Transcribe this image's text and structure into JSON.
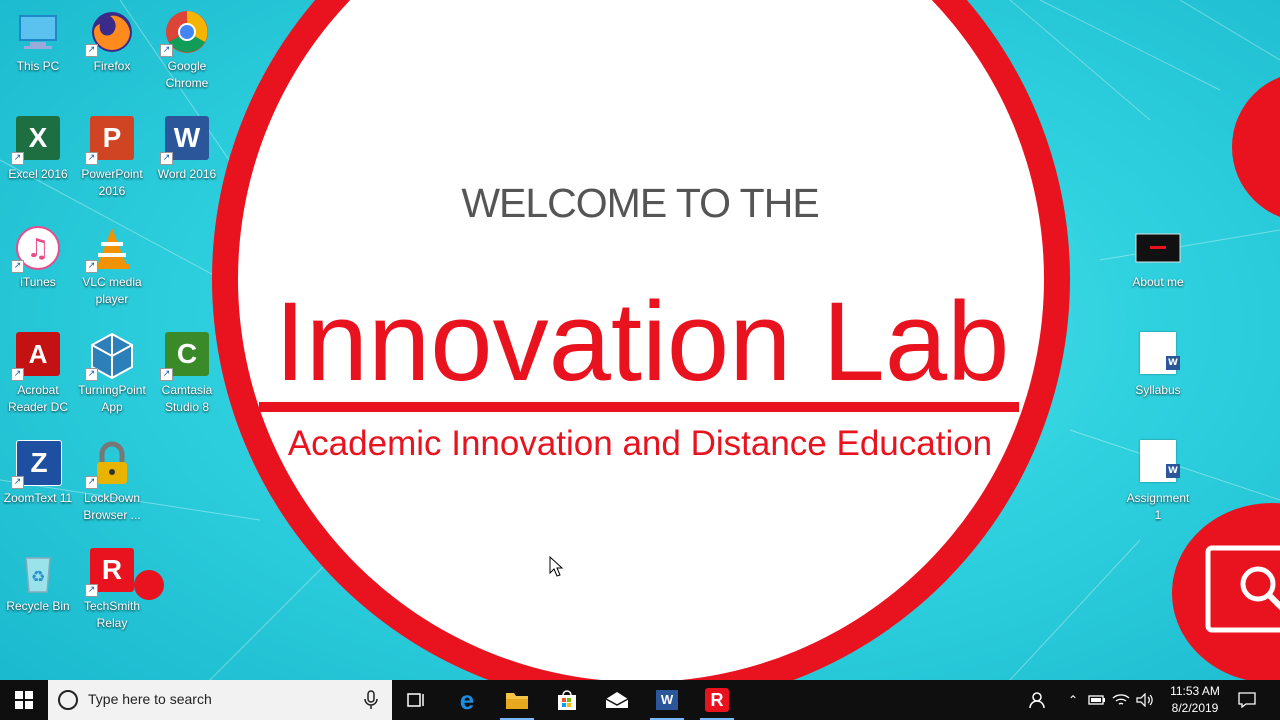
{
  "slide": {
    "welcome": "WELCOME TO THE",
    "title": "Innovation Lab",
    "subtitle": "Academic Innovation and Distance Education"
  },
  "desktop_icons": {
    "this_pc": "This PC",
    "firefox": "Firefox",
    "chrome": "Google\nChrome",
    "excel": "Excel 2016",
    "powerpoint": "PowerPoint\n2016",
    "word": "Word 2016",
    "itunes": "iTunes",
    "vlc": "VLC media\nplayer",
    "acrobat": "Acrobat\nReader DC",
    "turningpoint": "TurningPoint\nApp",
    "camtasia": "Camtasia\nStudio 8",
    "zoomtext": "ZoomText 11",
    "lockdown": "LockDown\nBrowser ...",
    "recycle": "Recycle Bin",
    "relay": "TechSmith\nRelay",
    "about_me": "About me",
    "syllabus": "Syllabus",
    "assignment": "Assignment\n1"
  },
  "taskbar": {
    "search_placeholder": "Type here to search",
    "time": "11:53 AM",
    "date": "8/2/2019"
  },
  "colors": {
    "brand_red": "#e8131f",
    "desktop_teal": "#2fd1df",
    "taskbar": "#0f0f10"
  }
}
